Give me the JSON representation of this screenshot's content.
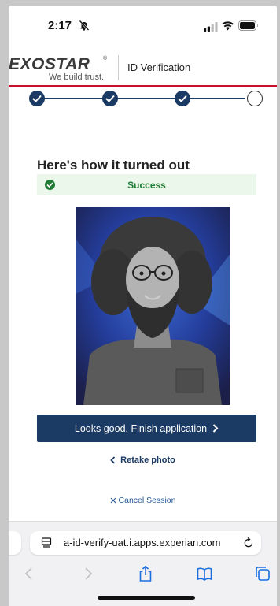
{
  "status_bar": {
    "time": "2:17"
  },
  "header": {
    "logo_text": "EXOSTAR",
    "logo_reg": "®",
    "logo_tagline": "We build trust.",
    "title": "ID Verification"
  },
  "stepper": {
    "completed_steps": 3,
    "total_steps": 4
  },
  "main": {
    "heading": "Here's how it turned out",
    "status": "Success",
    "finish_label": "Looks good. Finish application",
    "retake_label": "Retake photo",
    "cancel_label": "Cancel Session"
  },
  "browser": {
    "url": "a-id-verify-uat.i.apps.experian.com"
  },
  "icons": {
    "status": [
      "bell-slash-icon",
      "signal-icon",
      "wifi-icon",
      "battery-icon"
    ],
    "browser": [
      "page-icon",
      "reload-icon",
      "back-icon",
      "forward-icon",
      "share-icon",
      "bookmarks-icon",
      "tabs-icon"
    ]
  },
  "colors": {
    "primary": "#1b3a64",
    "accent_red": "#c8102e",
    "success": "#1f7a35",
    "success_bg": "#eaf7ea"
  }
}
